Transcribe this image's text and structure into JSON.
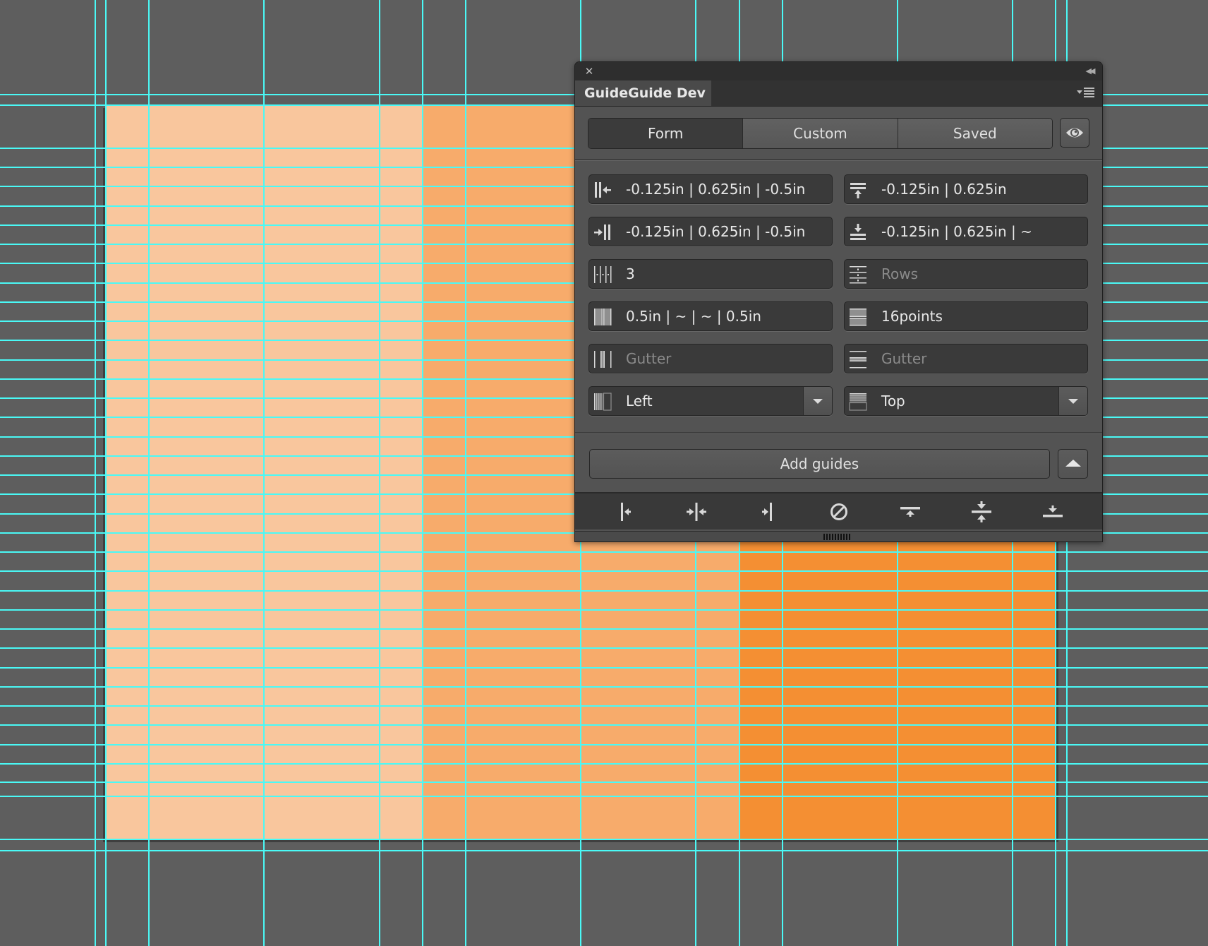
{
  "canvas": {
    "background_color": "#5e5e5e",
    "guide_color": "#4af9f6",
    "artboard_columns": [
      {
        "name": "column-1",
        "color": "#f9c69d"
      },
      {
        "name": "column-2",
        "color": "#f7ab6b"
      },
      {
        "name": "column-3",
        "color": "#f48f33"
      }
    ]
  },
  "panel": {
    "title": "GuideGuide Dev",
    "close_icon": "close-icon",
    "collapse_icon": "double-chevron-left-icon",
    "menu_icon": "flyout-menu-icon",
    "tabs": [
      {
        "label": "Form",
        "active": true
      },
      {
        "label": "Custom",
        "active": false
      },
      {
        "label": "Saved",
        "active": false
      }
    ],
    "visibility_icon": "eye-icon",
    "fields": {
      "left_margin": {
        "icon": "left-margin-icon",
        "value": "-0.125in | 0.625in | -0.5in",
        "placeholder": ""
      },
      "top_margin": {
        "icon": "top-margin-icon",
        "value": "-0.125in | 0.625in",
        "placeholder": ""
      },
      "right_margin": {
        "icon": "right-margin-icon",
        "value": "-0.125in | 0.625in | -0.5in",
        "placeholder": ""
      },
      "bottom_margin": {
        "icon": "bottom-margin-icon",
        "value": "-0.125in | 0.625in | ~",
        "placeholder": ""
      },
      "columns": {
        "icon": "columns-icon",
        "value": "3",
        "placeholder": ""
      },
      "rows": {
        "icon": "rows-icon",
        "value": "",
        "placeholder": "Rows"
      },
      "column_width": {
        "icon": "column-width-icon",
        "value": "0.5in | ~ | ~ | 0.5in",
        "placeholder": ""
      },
      "row_height": {
        "icon": "row-height-icon",
        "value": "16points",
        "placeholder": ""
      },
      "column_gutter": {
        "icon": "column-gutter-icon",
        "value": "",
        "placeholder": "Gutter"
      },
      "row_gutter": {
        "icon": "row-gutter-icon",
        "value": "",
        "placeholder": "Gutter"
      },
      "horizontal_position": {
        "icon": "column-position-icon",
        "value": "Left"
      },
      "vertical_position": {
        "icon": "row-position-icon",
        "value": "Top"
      }
    },
    "add_button_label": "Add guides",
    "expand_icon": "triangle-up-icon",
    "toolbar": [
      {
        "name": "guide-left-button",
        "icon": "guide-left-icon"
      },
      {
        "name": "guide-vertical-midpoint-button",
        "icon": "guide-vertical-midpoint-icon"
      },
      {
        "name": "guide-right-button",
        "icon": "guide-right-icon"
      },
      {
        "name": "clear-guides-button",
        "icon": "clear-icon"
      },
      {
        "name": "guide-top-button",
        "icon": "guide-top-icon"
      },
      {
        "name": "guide-horizontal-midpoint-button",
        "icon": "guide-horizontal-midpoint-icon"
      },
      {
        "name": "guide-bottom-button",
        "icon": "guide-bottom-icon"
      }
    ]
  }
}
